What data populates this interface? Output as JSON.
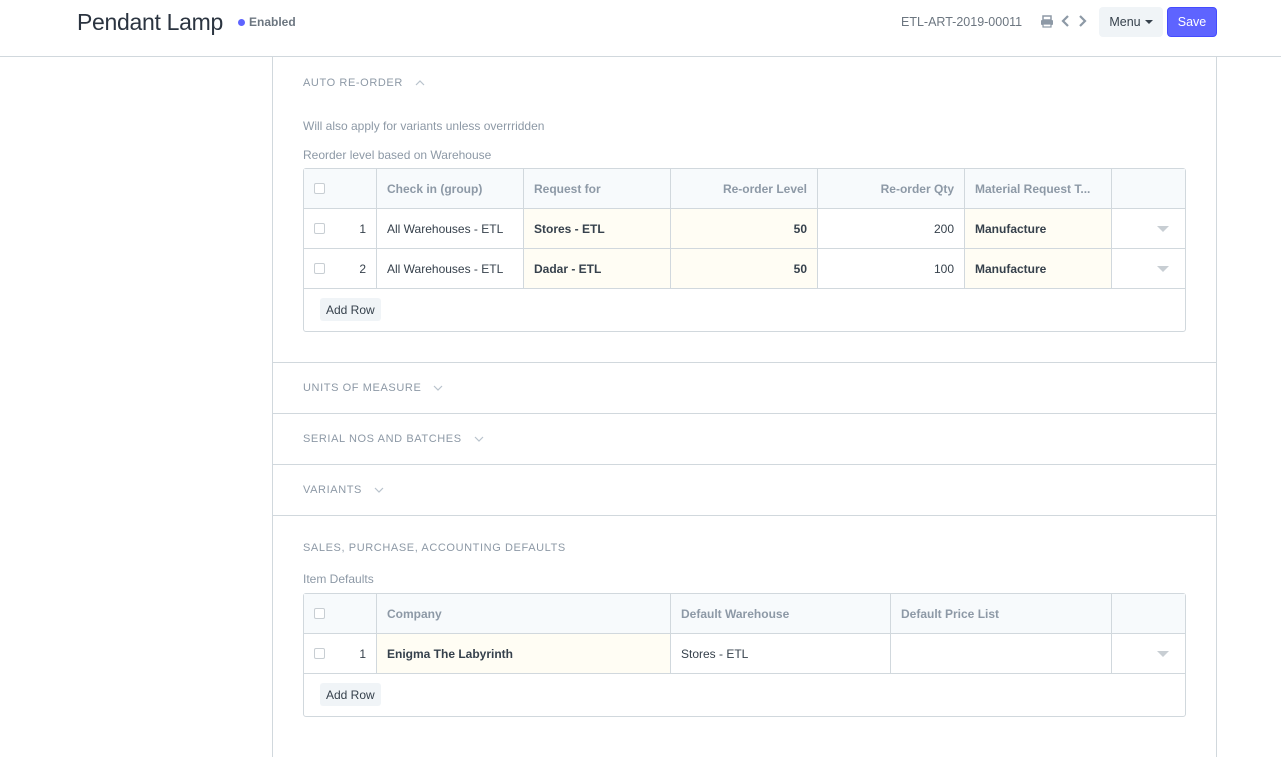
{
  "header": {
    "title": "Pendant Lamp",
    "status": "Enabled",
    "status_color": "#5e64ff",
    "doc_name": "ETL-ART-2019-00011",
    "menu_label": "Menu",
    "save_label": "Save"
  },
  "auto_reorder": {
    "title": "AUTO RE-ORDER",
    "expanded": true,
    "note": "Will also apply for variants unless overrridden",
    "table_label": "Reorder level based on Warehouse",
    "columns": [
      "Check in (group)",
      "Request for",
      "Re-order Level",
      "Re-order Qty",
      "Material Request T..."
    ],
    "rows": [
      {
        "idx": "1",
        "check_in": "All Warehouses - ETL",
        "request_for": "Stores - ETL",
        "reorder_level": "50",
        "reorder_qty": "200",
        "mr_type": "Manufacture"
      },
      {
        "idx": "2",
        "check_in": "All Warehouses - ETL",
        "request_for": "Dadar - ETL",
        "reorder_level": "50",
        "reorder_qty": "100",
        "mr_type": "Manufacture"
      }
    ],
    "add_row_label": "Add Row"
  },
  "collapsed_sections": [
    {
      "title": "UNITS OF MEASURE"
    },
    {
      "title": "SERIAL NOS AND BATCHES"
    },
    {
      "title": "VARIANTS"
    }
  ],
  "defaults": {
    "title": "SALES, PURCHASE, ACCOUNTING DEFAULTS",
    "table_label": "Item Defaults",
    "columns": [
      "Company",
      "Default Warehouse",
      "Default Price List"
    ],
    "rows": [
      {
        "idx": "1",
        "company": "Enigma The Labyrinth",
        "default_warehouse": "Stores - ETL",
        "default_price_list": ""
      }
    ],
    "add_row_label": "Add Row"
  }
}
